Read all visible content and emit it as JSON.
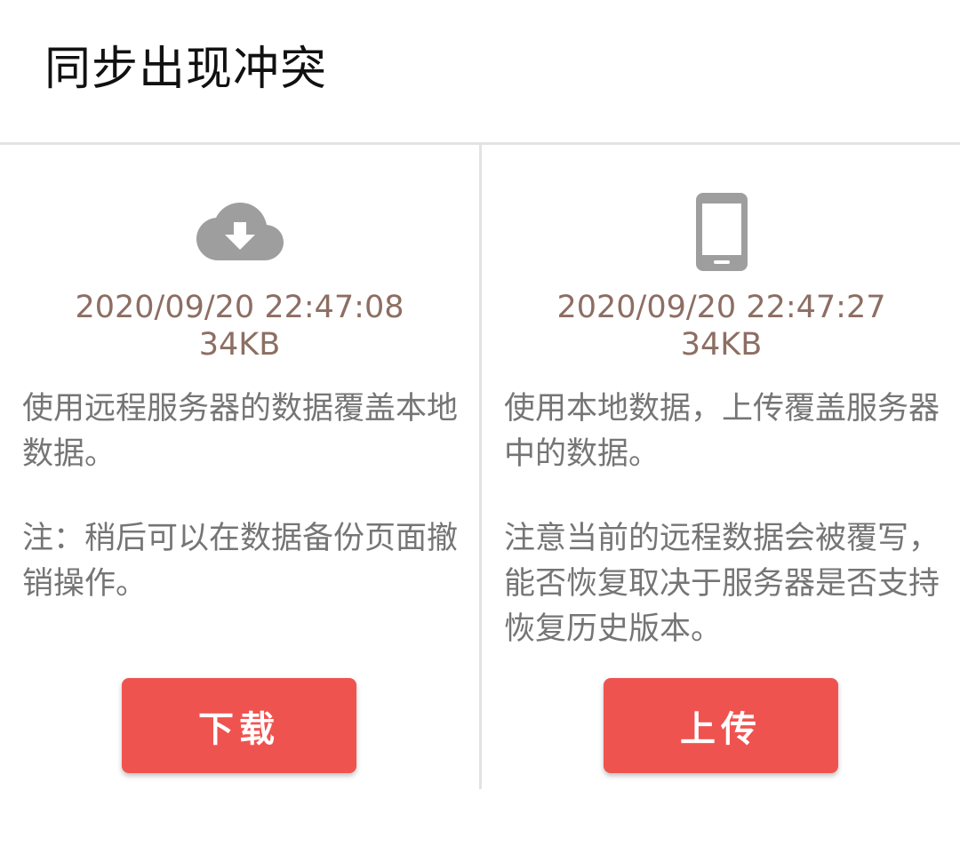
{
  "dialog": {
    "title": "同步出现冲突"
  },
  "remote": {
    "icon": "cloud-download-icon",
    "timestamp": "2020/09/20 22:47:08",
    "size": "34KB",
    "description": "使用远程服务器的数据覆盖本地数据。",
    "note": "注：稍后可以在数据备份页面撤销操作。",
    "button_label": "下载"
  },
  "local": {
    "icon": "smartphone-icon",
    "timestamp": "2020/09/20 22:47:27",
    "size": "34KB",
    "description": "使用本地数据，上传覆盖服务器中的数据。",
    "note": "注意当前的远程数据会被覆写，能否恢复取决于服务器是否支持恢复历史版本。",
    "button_label": "上传"
  },
  "colors": {
    "accent": "#ef5350",
    "meta_text": "#8d6e63",
    "body_text": "#757575",
    "icon": "#9e9e9e"
  }
}
